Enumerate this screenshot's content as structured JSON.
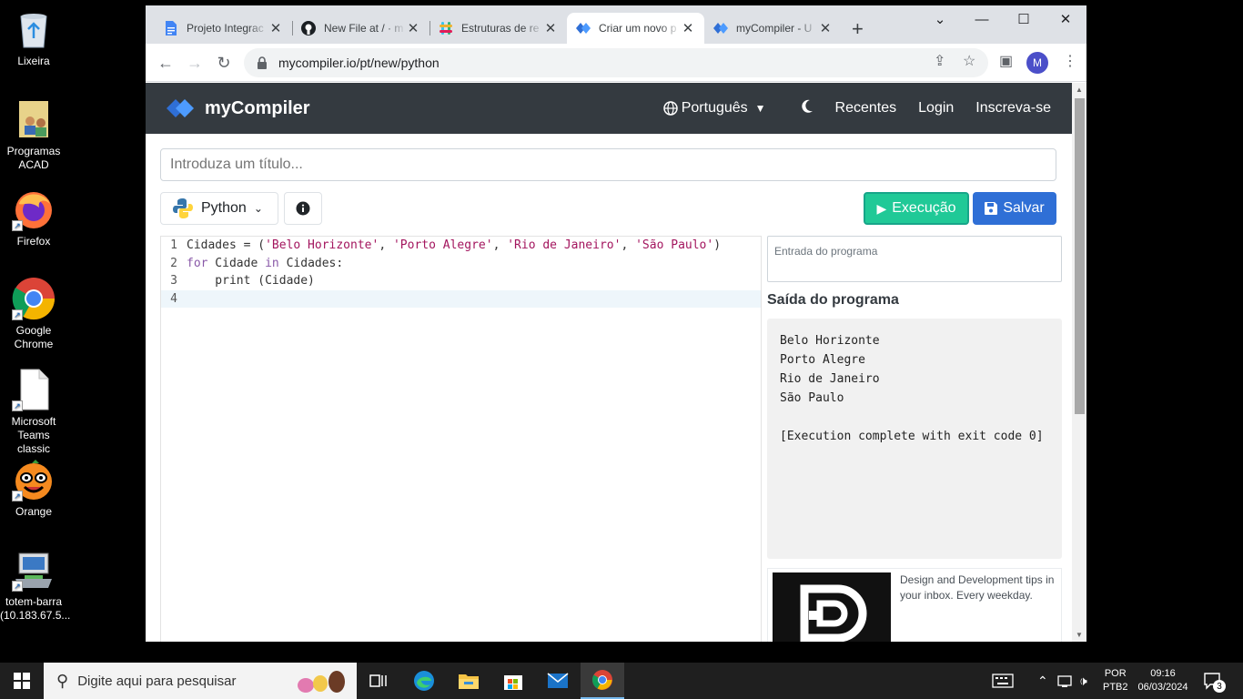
{
  "desktop": {
    "icons": [
      {
        "label": "Lixeira",
        "icon": "recycle-bin-icon"
      },
      {
        "label": "Programas ACAD",
        "icon": "users-folder-icon"
      },
      {
        "label": "Firefox",
        "icon": "firefox-icon"
      },
      {
        "label": "Google Chrome",
        "icon": "chrome-icon"
      },
      {
        "label": "Microsoft Teams classic",
        "icon": "file-icon"
      },
      {
        "label": "Orange",
        "icon": "orange-icon"
      },
      {
        "label": "totem-barra (10.183.67.5...",
        "icon": "remote-desktop-icon"
      }
    ]
  },
  "browser": {
    "tabs": [
      {
        "label": "Projeto Integrac",
        "icon": "google-docs-icon",
        "active": false
      },
      {
        "label": "New File at / · m",
        "icon": "github-icon",
        "active": false
      },
      {
        "label": "Estruturas de re",
        "icon": "slack-icon",
        "active": false
      },
      {
        "label": "Criar um novo p",
        "icon": "mycompiler-icon",
        "active": true
      },
      {
        "label": "myCompiler - U",
        "icon": "mycompiler-icon",
        "active": false
      }
    ],
    "url": "mycompiler.io/pt/new/python",
    "profile_initial": "M"
  },
  "site": {
    "brand": "myCompiler",
    "nav": {
      "language": "Português",
      "recent": "Recentes",
      "login": "Login",
      "signup": "Inscreva-se"
    },
    "title_placeholder": "Introduza um título...",
    "language_selector": "Python",
    "run_label": "Execução",
    "save_label": "Salvar",
    "code_lines": [
      {
        "num": "1",
        "tokens": [
          [
            "plain",
            "Cidades = ("
          ],
          [
            "str",
            "'Belo Horizonte'"
          ],
          [
            "plain",
            ", "
          ],
          [
            "str",
            "'Porto Alegre'"
          ],
          [
            "plain",
            ", "
          ],
          [
            "str",
            "'Rio de Janeiro'"
          ],
          [
            "plain",
            ", "
          ],
          [
            "str",
            "'São Paulo'"
          ],
          [
            "plain",
            ")"
          ]
        ]
      },
      {
        "num": "2",
        "tokens": [
          [
            "kw",
            "for"
          ],
          [
            "plain",
            " Cidade "
          ],
          [
            "kw",
            "in"
          ],
          [
            "plain",
            " Cidades:"
          ]
        ]
      },
      {
        "num": "3",
        "tokens": [
          [
            "plain",
            "    print (Cidade)"
          ]
        ]
      },
      {
        "num": "4",
        "tokens": []
      }
    ],
    "stdin_placeholder": "Entrada do programa",
    "output_title": "Saída do programa",
    "output_lines": [
      "Belo Horizonte",
      "Porto Alegre",
      "Rio de Janeiro",
      "São Paulo",
      "",
      "[Execution complete with exit code 0]"
    ],
    "ad_text": "Design and Development tips in your inbox. Every weekday."
  },
  "taskbar": {
    "search_placeholder": "Digite aqui para pesquisar",
    "lang_top": "POR",
    "lang_bottom": "PTB2",
    "time": "09:16",
    "date": "06/03/2024",
    "notifications": "3"
  }
}
